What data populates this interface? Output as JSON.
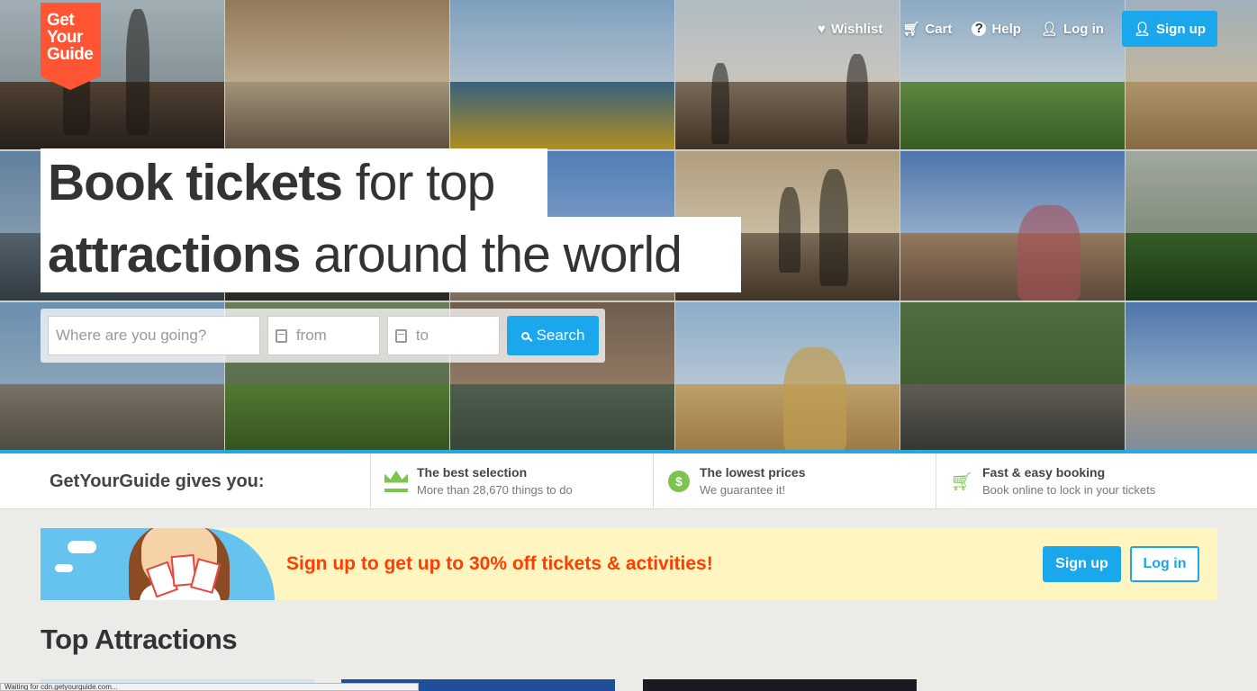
{
  "logo": {
    "line1": "Get",
    "line2": "Your",
    "line3": "Guide",
    "color": "#ff5533"
  },
  "nav": {
    "wishlist": "Wishlist",
    "cart": "Cart",
    "help": "Help",
    "login": "Log in",
    "signup": "Sign up"
  },
  "hero": {
    "headline_bold_1": "Book tickets",
    "headline_rest_1": " for top",
    "headline_bold_2": "attractions",
    "headline_rest_2": " around the world"
  },
  "search": {
    "destination_placeholder": "Where are you going?",
    "from_placeholder": "from",
    "to_placeholder": "to",
    "button": "Search"
  },
  "benefits": {
    "title": "GetYourGuide gives you:",
    "items": [
      {
        "title": "The best selection",
        "subtitle": "More than 28,670 things to do",
        "icon": "crown-icon"
      },
      {
        "title": "The lowest prices",
        "subtitle": "We guarantee it!",
        "icon": "dollar-badge-icon"
      },
      {
        "title": "Fast & easy booking",
        "subtitle": "Book online to lock in your tickets",
        "icon": "cart-icon"
      }
    ]
  },
  "promo": {
    "text": "Sign up to get up to 30% off tickets & activities!",
    "signup": "Sign up",
    "login": "Log in"
  },
  "section": {
    "top_attractions": "Top Attractions"
  },
  "status_bar": "Waiting for cdn.getyourguide.com...",
  "colors": {
    "accent": "#1aa7ec",
    "brand": "#ff5533",
    "promo_text": "#ff3d00",
    "benefit_green": "#7dc44e"
  }
}
